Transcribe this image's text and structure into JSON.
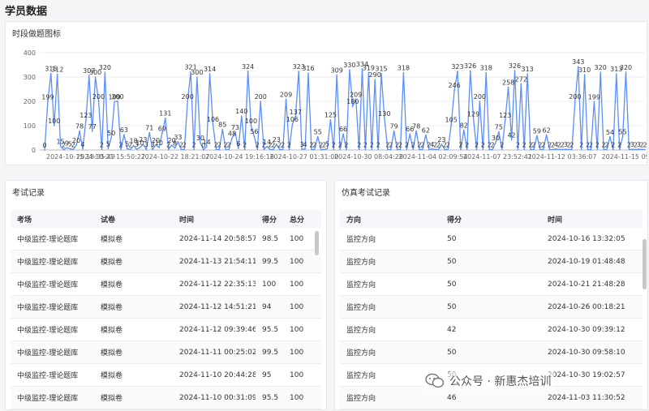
{
  "page": {
    "title": "学员数据"
  },
  "chart_card": {
    "title": "时段做题图标"
  },
  "chart_data": {
    "type": "line",
    "title": "时段做题图标",
    "ylim": [
      0,
      400
    ],
    "yticks": [
      0,
      100,
      200,
      300,
      400
    ],
    "x_tick_labels": [
      "2024-10-15 18:35:49",
      "2024-10-21 15:50:27",
      "2024-10-22 18:21:07",
      "2024-10-24 19:16:16",
      "2024-10-27 01:31:00",
      "2024-10-30 08:04:28",
      "2024-11-04 02:09:54",
      "2024-11-07 23:52:41",
      "2024-11-12 03:36:07",
      "2024-11-15 09:"
    ],
    "color": "#5b8ff9",
    "values": [
      0,
      199,
      315,
      100,
      312,
      15,
      2,
      9,
      5,
      2,
      20,
      78,
      4,
      123,
      307,
      77,
      300,
      200,
      2,
      320,
      5,
      50,
      199,
      200,
      2,
      63,
      5,
      2,
      18,
      3,
      10,
      23,
      3,
      71,
      3,
      20,
      10,
      69,
      131,
      2,
      20,
      8,
      33,
      2,
      2,
      200,
      321,
      2,
      300,
      30,
      0,
      14,
      314,
      106,
      2,
      2,
      85,
      2,
      2,
      48,
      73,
      6,
      140,
      2,
      324,
      100,
      56,
      2,
      200,
      2,
      14,
      2,
      2,
      23,
      2,
      2,
      209,
      2,
      106,
      137,
      323,
      3,
      4,
      316,
      2,
      2,
      55,
      2,
      2,
      5,
      125,
      2,
      309,
      2,
      66,
      2,
      330,
      180,
      209,
      2,
      334,
      2,
      319,
      2,
      290,
      2,
      315,
      130,
      2,
      2,
      79,
      2,
      2,
      318,
      2,
      66,
      2,
      78,
      2,
      2,
      62,
      2,
      4,
      2,
      2,
      23,
      2,
      2,
      105,
      246,
      323,
      2,
      82,
      2,
      326,
      129,
      2,
      200,
      2,
      318,
      2,
      2,
      30,
      75,
      2,
      123,
      258,
      42,
      326,
      2,
      272,
      2,
      313,
      2,
      2,
      59,
      2,
      2,
      62,
      2,
      2,
      4,
      2,
      2,
      3,
      2,
      2,
      200,
      343,
      2,
      310,
      2,
      2,
      199,
      2,
      320,
      2,
      2,
      54,
      2,
      313,
      2,
      55,
      320,
      2,
      3,
      2,
      3,
      2,
      2
    ]
  },
  "exam_card": {
    "title": "考试记录",
    "headers": [
      "考场",
      "试卷",
      "时间",
      "得分",
      "总分"
    ],
    "rows": [
      [
        "中级监控-理论题库",
        "模拟卷",
        "2024-11-14 20:58:57",
        "98.5",
        "100"
      ],
      [
        "中级监控-理论题库",
        "模拟卷",
        "2024-11-13 21:54:11",
        "99.5",
        "100"
      ],
      [
        "中级监控-理论题库",
        "模拟卷",
        "2024-11-12 22:35:13",
        "100",
        "100"
      ],
      [
        "中级监控-理论题库",
        "模拟卷",
        "2024-11-12 14:51:21",
        "94",
        "100"
      ],
      [
        "中级监控-理论题库",
        "模拟卷",
        "2024-11-12 09:39:46",
        "95.5",
        "100"
      ],
      [
        "中级监控-理论题库",
        "模拟卷",
        "2024-11-11 00:25:02",
        "99.5",
        "100"
      ],
      [
        "中级监控-理论题库",
        "模拟卷",
        "2024-11-10 20:44:28",
        "95",
        "100"
      ],
      [
        "中级监控-理论题库",
        "模拟卷",
        "2024-11-10 00:31:09",
        "95.5",
        "100"
      ]
    ]
  },
  "sim_card": {
    "title": "仿真考试记录",
    "headers": [
      "方向",
      "得分",
      "时间"
    ],
    "rows": [
      [
        "监控方向",
        "50",
        "2024-10-16 13:32:05"
      ],
      [
        "监控方向",
        "50",
        "2024-10-19 01:48:48"
      ],
      [
        "监控方向",
        "50",
        "2024-10-21 21:48:28"
      ],
      [
        "监控方向",
        "50",
        "2024-10-26 00:18:21"
      ],
      [
        "监控方向",
        "42",
        "2024-10-30 09:39:12"
      ],
      [
        "监控方向",
        "50",
        "2024-10-30 09:58:10"
      ],
      [
        "监控方向",
        "50",
        "2024-10-30 19:02:57"
      ],
      [
        "监控方向",
        "46",
        "2024-11-03 11:30:52"
      ]
    ]
  },
  "watermark": {
    "text": "公众号 · 新惠杰培训"
  }
}
